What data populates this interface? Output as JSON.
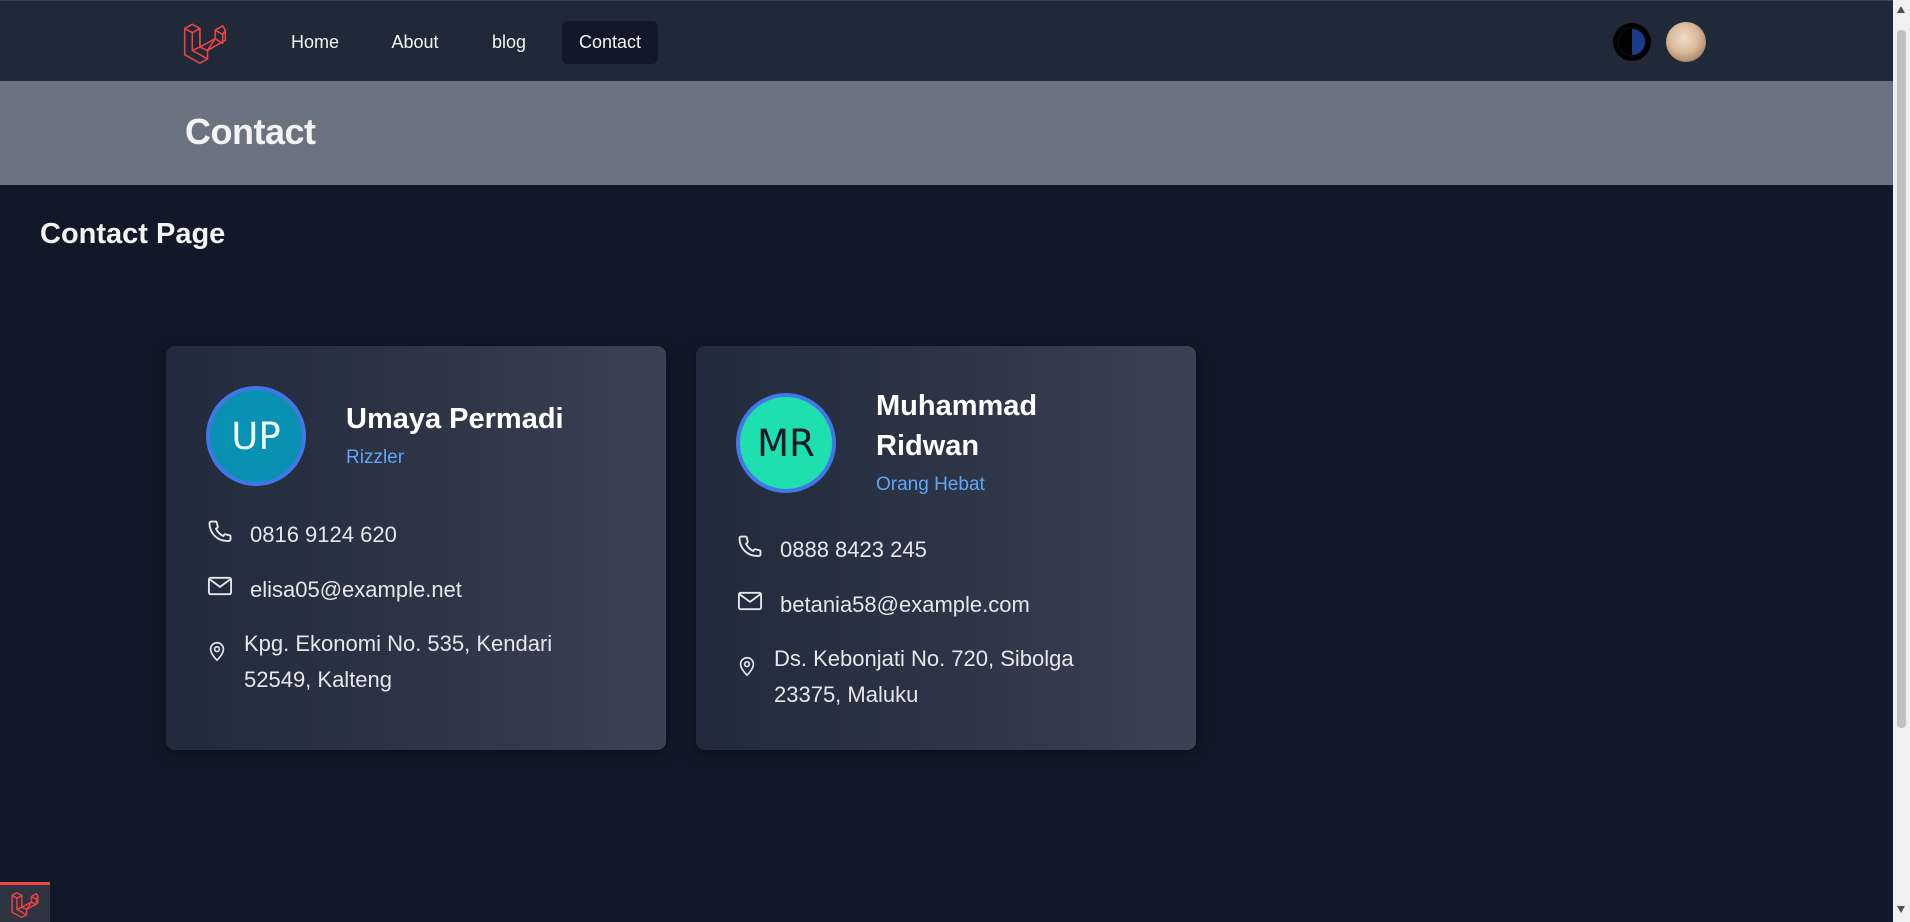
{
  "nav": {
    "links": [
      {
        "label": "Home"
      },
      {
        "label": "About"
      },
      {
        "label": "blog"
      },
      {
        "label": "Contact"
      }
    ],
    "active": "Contact"
  },
  "header": {
    "title": "Contact"
  },
  "section": {
    "title": "Contact Page"
  },
  "contacts": [
    {
      "initials": "UP",
      "avatar_color": "#0891b2",
      "name": "Umaya Permadi",
      "role": "Rizzler",
      "phone": "0816 9124 620",
      "email": "elisa05@example.net",
      "address": "Kpg. Ekonomi No. 535, Kendari 52549, Kalteng"
    },
    {
      "initials": "MR",
      "avatar_color": "#1de0ae",
      "name": "Muhammad Ridwan",
      "role": "Orang Hebat",
      "phone": "0888 8423 245",
      "email": "betania58@example.com",
      "address": "Ds. Kebonjati No. 720, Sibolga 23375, Maluku"
    }
  ],
  "colors": {
    "navbar_bg": "#1f2937",
    "page_bg": "#111827",
    "header_bg": "#6b7280",
    "accent": "#60a5fa",
    "brand_red": "#ef4444"
  },
  "icons": [
    "laravel-logo-icon",
    "theme-toggle-icon",
    "phone-icon",
    "mail-icon",
    "map-pin-icon"
  ]
}
